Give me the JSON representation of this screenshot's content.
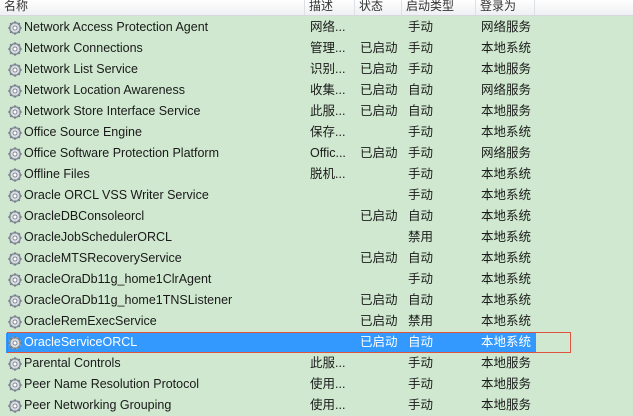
{
  "header": {
    "name": "名称",
    "description": "描述",
    "status": "状态",
    "startup_type": "启动类型",
    "logon_as": "登录为"
  },
  "services": [
    {
      "name": "Network Access Protection Agent",
      "description": "网络...",
      "status": "",
      "startup_type": "手动",
      "logon_as": "网络服务"
    },
    {
      "name": "Network Connections",
      "description": "管理...",
      "status": "已启动",
      "startup_type": "手动",
      "logon_as": "本地系统"
    },
    {
      "name": "Network List Service",
      "description": "识别...",
      "status": "已启动",
      "startup_type": "手动",
      "logon_as": "本地服务"
    },
    {
      "name": "Network Location Awareness",
      "description": "收集...",
      "status": "已启动",
      "startup_type": "自动",
      "logon_as": "网络服务"
    },
    {
      "name": "Network Store Interface Service",
      "description": "此服...",
      "status": "已启动",
      "startup_type": "自动",
      "logon_as": "本地服务"
    },
    {
      "name": "Office  Source Engine",
      "description": "保存...",
      "status": "",
      "startup_type": "手动",
      "logon_as": "本地系统"
    },
    {
      "name": "Office Software Protection Platform",
      "description": "Offic...",
      "status": "已启动",
      "startup_type": "手动",
      "logon_as": "网络服务"
    },
    {
      "name": "Offline Files",
      "description": "脱机...",
      "status": "",
      "startup_type": "手动",
      "logon_as": "本地系统"
    },
    {
      "name": "Oracle ORCL VSS Writer Service",
      "description": "",
      "status": "",
      "startup_type": "手动",
      "logon_as": "本地系统"
    },
    {
      "name": "OracleDBConsoleorcl",
      "description": "",
      "status": "已启动",
      "startup_type": "自动",
      "logon_as": "本地系统"
    },
    {
      "name": "OracleJobSchedulerORCL",
      "description": "",
      "status": "",
      "startup_type": "禁用",
      "logon_as": "本地系统"
    },
    {
      "name": "OracleMTSRecoveryService",
      "description": "",
      "status": "已启动",
      "startup_type": "自动",
      "logon_as": "本地系统"
    },
    {
      "name": "OracleOraDb11g_home1ClrAgent",
      "description": "",
      "status": "",
      "startup_type": "手动",
      "logon_as": "本地系统"
    },
    {
      "name": "OracleOraDb11g_home1TNSListener",
      "description": "",
      "status": "已启动",
      "startup_type": "自动",
      "logon_as": "本地系统"
    },
    {
      "name": "OracleRemExecService",
      "description": "",
      "status": "已启动",
      "startup_type": "禁用",
      "logon_as": "本地系统"
    },
    {
      "name": "OracleServiceORCL",
      "description": "",
      "status": "已启动",
      "startup_type": "自动",
      "logon_as": "本地系统",
      "selected": true
    },
    {
      "name": "Parental Controls",
      "description": "此服...",
      "status": "",
      "startup_type": "手动",
      "logon_as": "本地服务"
    },
    {
      "name": "Peer Name Resolution Protocol",
      "description": "使用...",
      "status": "",
      "startup_type": "手动",
      "logon_as": "本地服务"
    },
    {
      "name": "Peer Networking Grouping",
      "description": "使用...",
      "status": "",
      "startup_type": "手动",
      "logon_as": "本地服务"
    }
  ],
  "colors": {
    "background": "#cfe8cf",
    "selection": "#3399ff",
    "selection_outline": "#e0533f"
  },
  "icons": {
    "service": "gear-icon"
  }
}
